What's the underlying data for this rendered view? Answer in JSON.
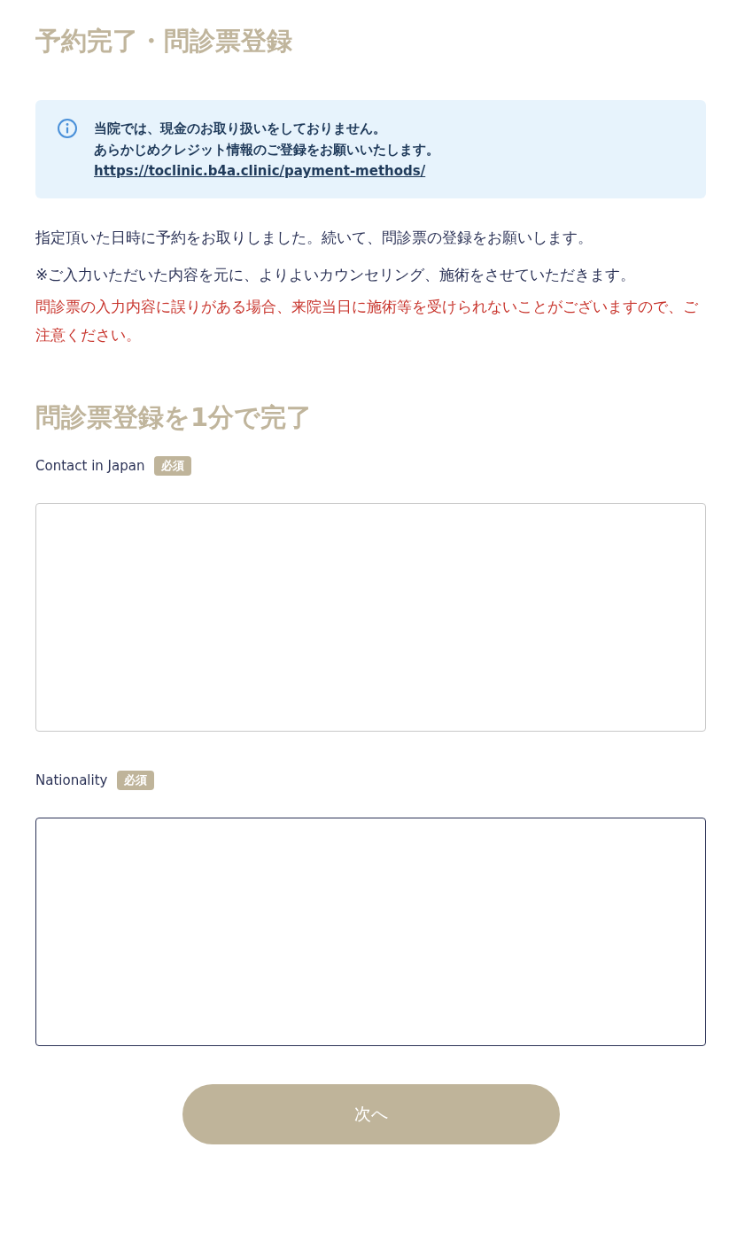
{
  "title": "予約完了・問診票登録",
  "notice": {
    "lines": [
      "当院では、現金のお取り扱いをしておりません。",
      "あらかじめクレジット情報のご登録をお願いいたします。"
    ],
    "link": "https://toclinic.b4a.clinic/payment-methods/"
  },
  "paragraphs": [
    {
      "kind": "normal",
      "text": "指定頂いた日時に予約をお取りしました。続いて、問診票の登録をお願いします。"
    },
    {
      "kind": "normal",
      "text": "※ご入力いただいた内容を元に、よりよいカウンセリング、施術をさせていただきます。"
    },
    {
      "kind": "warning",
      "text": "問診票の入力内容に誤りがある場合、来院当日に施術等を受けられないことがございますので、ご注意ください。"
    }
  ],
  "section_title": "問診票登録を1分で完了",
  "fields": [
    {
      "label": "Contact in Japan",
      "badge": "必須",
      "focused": false
    },
    {
      "label": "Nationality",
      "badge": "必須",
      "focused": true
    }
  ],
  "button": "次へ"
}
